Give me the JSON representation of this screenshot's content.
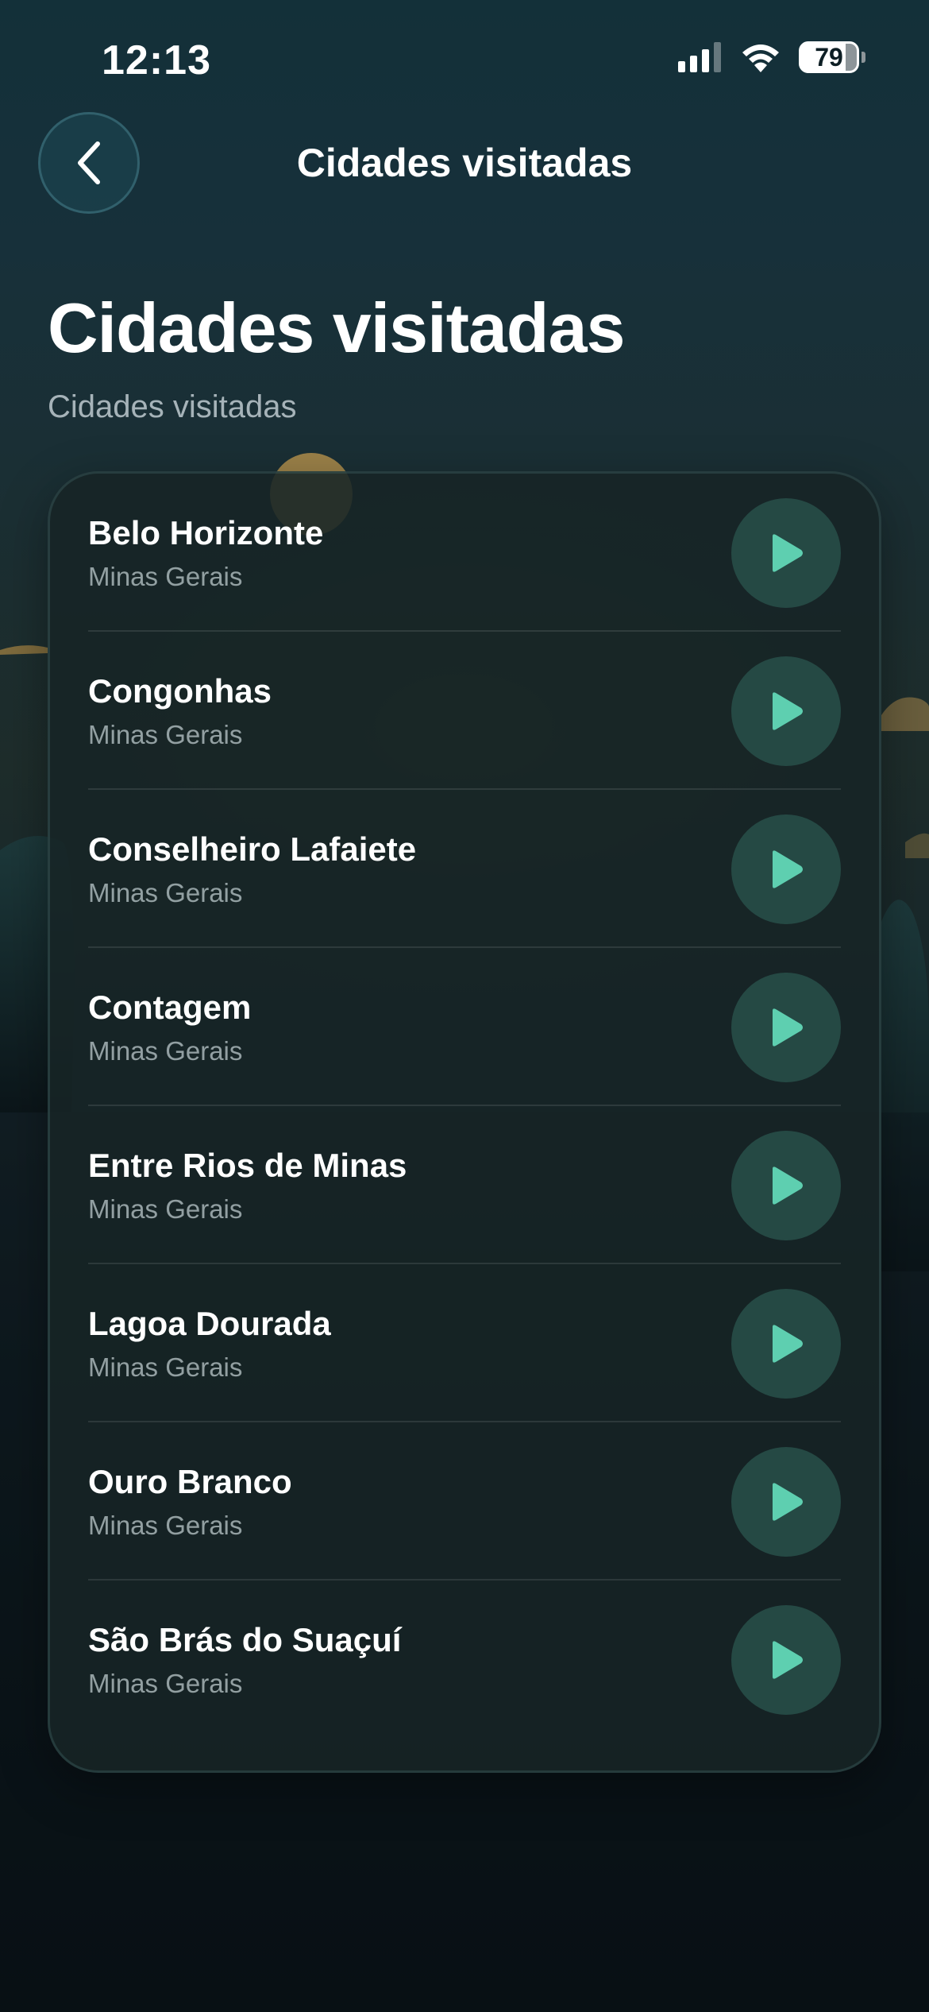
{
  "status_bar": {
    "time": "12:13",
    "battery": "79",
    "icons": [
      "cellular-signal-icon",
      "wifi-icon",
      "battery-icon"
    ]
  },
  "header": {
    "back_icon": "chevron-left-icon",
    "title": "Cidades visitadas"
  },
  "page": {
    "title": "Cidades visitadas",
    "subtitle": "Cidades visitadas"
  },
  "cities": [
    {
      "name": "Belo Horizonte",
      "state": "Minas Gerais"
    },
    {
      "name": "Congonhas",
      "state": "Minas Gerais"
    },
    {
      "name": "Conselheiro Lafaiete",
      "state": "Minas Gerais"
    },
    {
      "name": "Contagem",
      "state": "Minas Gerais"
    },
    {
      "name": "Entre Rios de Minas",
      "state": "Minas Gerais"
    },
    {
      "name": "Lagoa Dourada",
      "state": "Minas Gerais"
    },
    {
      "name": "Ouro Branco",
      "state": "Minas Gerais"
    },
    {
      "name": "São Brás do Suaçuí",
      "state": "Minas Gerais"
    }
  ],
  "colors": {
    "accent": "#5ecfb0",
    "background_top": "#133039",
    "background_bottom": "#070e12",
    "card": "#172426"
  }
}
